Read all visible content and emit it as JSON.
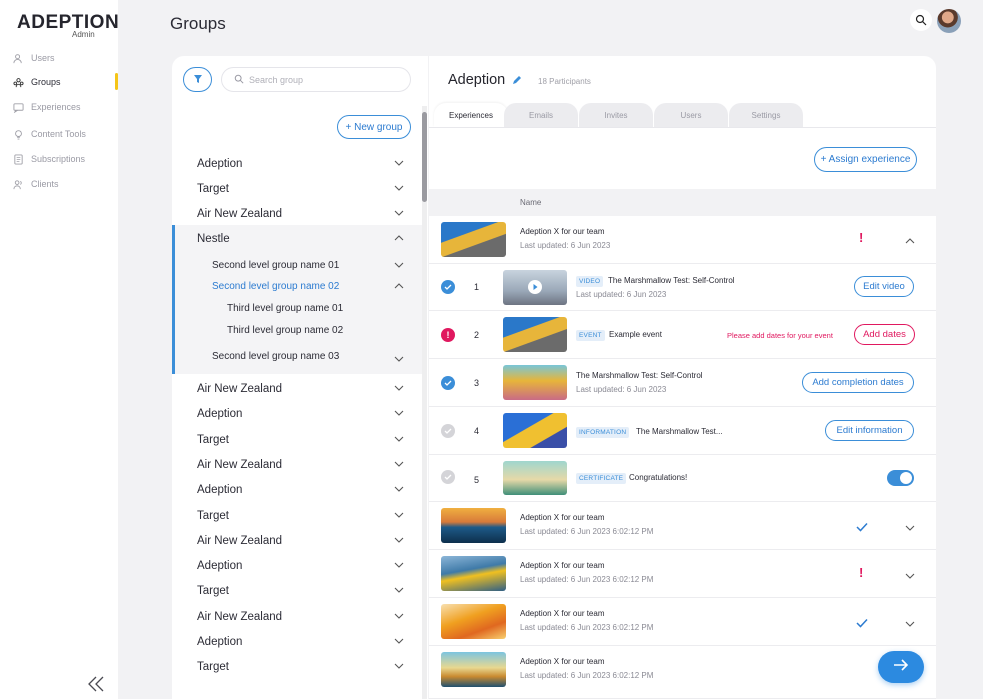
{
  "app": {
    "logo": "ADEPTION",
    "logo_sub": "Admin",
    "page_title": "Groups"
  },
  "nav": {
    "items": [
      {
        "label": "Users",
        "icon": "users-icon"
      },
      {
        "label": "Groups",
        "icon": "groups-icon",
        "active": true
      },
      {
        "label": "Experiences",
        "icon": "chat-icon"
      },
      {
        "label": "Content Tools",
        "icon": "lightbulb-icon"
      },
      {
        "label": "Subscriptions",
        "icon": "document-icon"
      },
      {
        "label": "Clients",
        "icon": "clients-icon"
      }
    ],
    "accent": "#f5c518"
  },
  "groups": {
    "search_placeholder": "Search group",
    "new_group_label": "+ New group",
    "list": [
      {
        "label": "Adeption",
        "expanded": false
      },
      {
        "label": "Target",
        "expanded": false
      },
      {
        "label": "Air New Zealand",
        "expanded": false
      },
      {
        "label": "Nestle",
        "expanded": true
      },
      {
        "label": "Second level group name 01",
        "level": 2
      },
      {
        "label": "Second level group name 02",
        "level": 2,
        "selected": true
      },
      {
        "label": "Third level group name 01",
        "level": 3
      },
      {
        "label": "Third level group name 02",
        "level": 3
      },
      {
        "label": "Second level group name 03",
        "level": 2
      },
      {
        "label": "Air New Zealand"
      },
      {
        "label": "Adeption"
      },
      {
        "label": "Target"
      },
      {
        "label": "Air New Zealand"
      },
      {
        "label": "Adeption"
      },
      {
        "label": "Target"
      },
      {
        "label": "Air New Zealand"
      },
      {
        "label": "Adeption"
      },
      {
        "label": "Target"
      },
      {
        "label": "Air New Zealand"
      },
      {
        "label": "Adeption"
      },
      {
        "label": "Target"
      }
    ]
  },
  "detail": {
    "title": "Adeption",
    "participants": "18 Participants",
    "tabs": [
      "Experiences",
      "Emails",
      "Invites",
      "Users",
      "Settings"
    ],
    "active_tab": "Experiences",
    "assign_label": "+ Assign experience",
    "column_name": "Name",
    "experience": {
      "title": "Adeption X for our team",
      "updated": "Last updated: 6 Jun 2023",
      "alert": "!"
    },
    "steps": [
      {
        "num": "1",
        "status": "done",
        "tag": "VIDEO",
        "title": "The Marshmallow Test: Self-Control",
        "updated": "Last updated: 6 Jun 2023",
        "action": "Edit video"
      },
      {
        "num": "2",
        "status": "error",
        "tag": "EVENT",
        "title": "Example event",
        "warning": "Please add dates for your event",
        "action": "Add dates"
      },
      {
        "num": "3",
        "status": "done",
        "title": "The Marshmallow Test: Self-Control",
        "updated": "Last updated: 6 Jun 2023",
        "action": "Add completion dates"
      },
      {
        "num": "4",
        "status": "pending",
        "tag": "INFORMATION",
        "title": "The Marshmallow Test...",
        "action": "Edit information"
      },
      {
        "num": "5",
        "status": "pending",
        "tag": "CERTIFICATE",
        "title": "Congratulations!",
        "toggle": true
      }
    ],
    "more_experiences": [
      {
        "title": "Adeption X for our team",
        "updated": "Last updated: 6 Jun 2023 6:02:12 PM",
        "status": "check"
      },
      {
        "title": "Adeption X for our team",
        "updated": "Last updated: 6 Jun 2023 6:02:12 PM",
        "status": "alert"
      },
      {
        "title": "Adeption X for our team",
        "updated": "Last updated: 6 Jun 2023 6:02:12 PM",
        "status": "check"
      },
      {
        "title": "Adeption X for our team",
        "updated": "Last updated: 6 Jun 2023 6:02:12 PM",
        "status": "none"
      }
    ],
    "error_mark": "!"
  },
  "colors": {
    "primary": "#3b8ed8",
    "danger": "#e0185f"
  }
}
